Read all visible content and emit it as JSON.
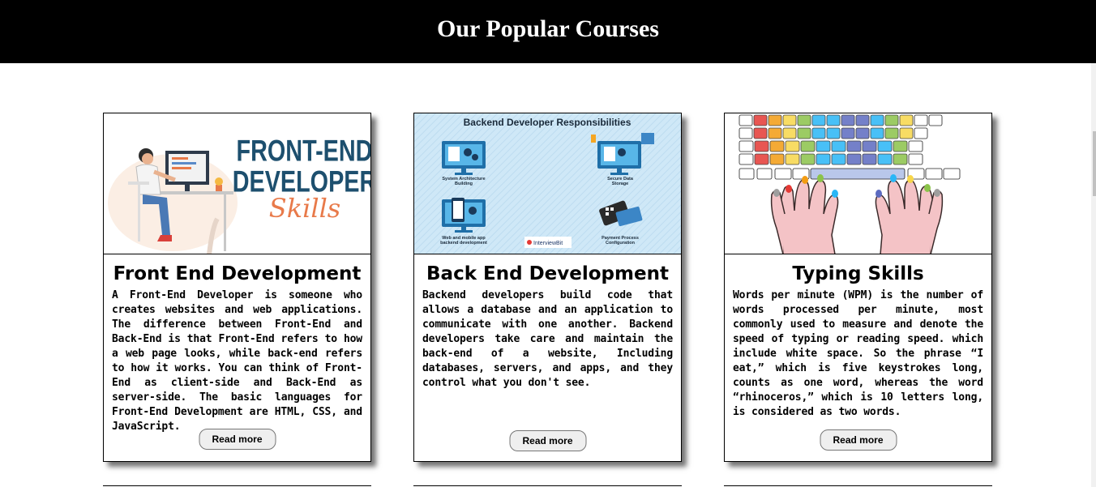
{
  "header": {
    "title": "Our Popular Courses"
  },
  "courses": [
    {
      "title": "Front End Development",
      "image_text_1": "FRONT-END",
      "image_text_2": "DEVELOPER",
      "image_text_3": "Skills",
      "description": "A Front-End Developer is someone who creates websites and web applications. The difference between Front-End and Back-End is that Front-End refers to how a web page looks, while back-end refers to how it works. You can think of Front-End as client-side and Back-End as server-side. The basic languages for Front-End Development are HTML, CSS, and JavaScript.",
      "button": "Read more"
    },
    {
      "title": "Back End Development",
      "image_heading": "Backend Developer Responsibilities",
      "image_labels": [
        "System Architecture Building",
        "Secure Data Storage",
        "Web and mobile app backend development",
        "Payment Process Configuration"
      ],
      "image_brand": "InterviewBit",
      "description": "Backend developers build code that allows a database and an application to communicate with one another. Backend developers take care and maintain the back-end of a website, Including databases, servers, and apps, and they control what you don't see.",
      "button": "Read more"
    },
    {
      "title": "Typing Skills",
      "description": "Words per minute (WPM) is the number of words processed per minute, most commonly used to measure and denote the speed of typing or reading speed. which include white space. So the phrase “I eat,” which is five keystrokes long, counts as one word, whereas the word “rhinoceros,” which is 10 letters long, is considered as two words.",
      "button": "Read more"
    }
  ],
  "colors": {
    "header_bg": "#000000",
    "header_text": "#ffffff",
    "frontend_title": "#1d4f6e",
    "frontend_accent": "#e87a4a",
    "backend_bg": "#cfe8f7",
    "keyboard_keys": [
      "#e53935",
      "#f39c12",
      "#f7d64a",
      "#8bc34a",
      "#29b6f6",
      "#5c6bc0",
      "#9e9e9e"
    ]
  }
}
